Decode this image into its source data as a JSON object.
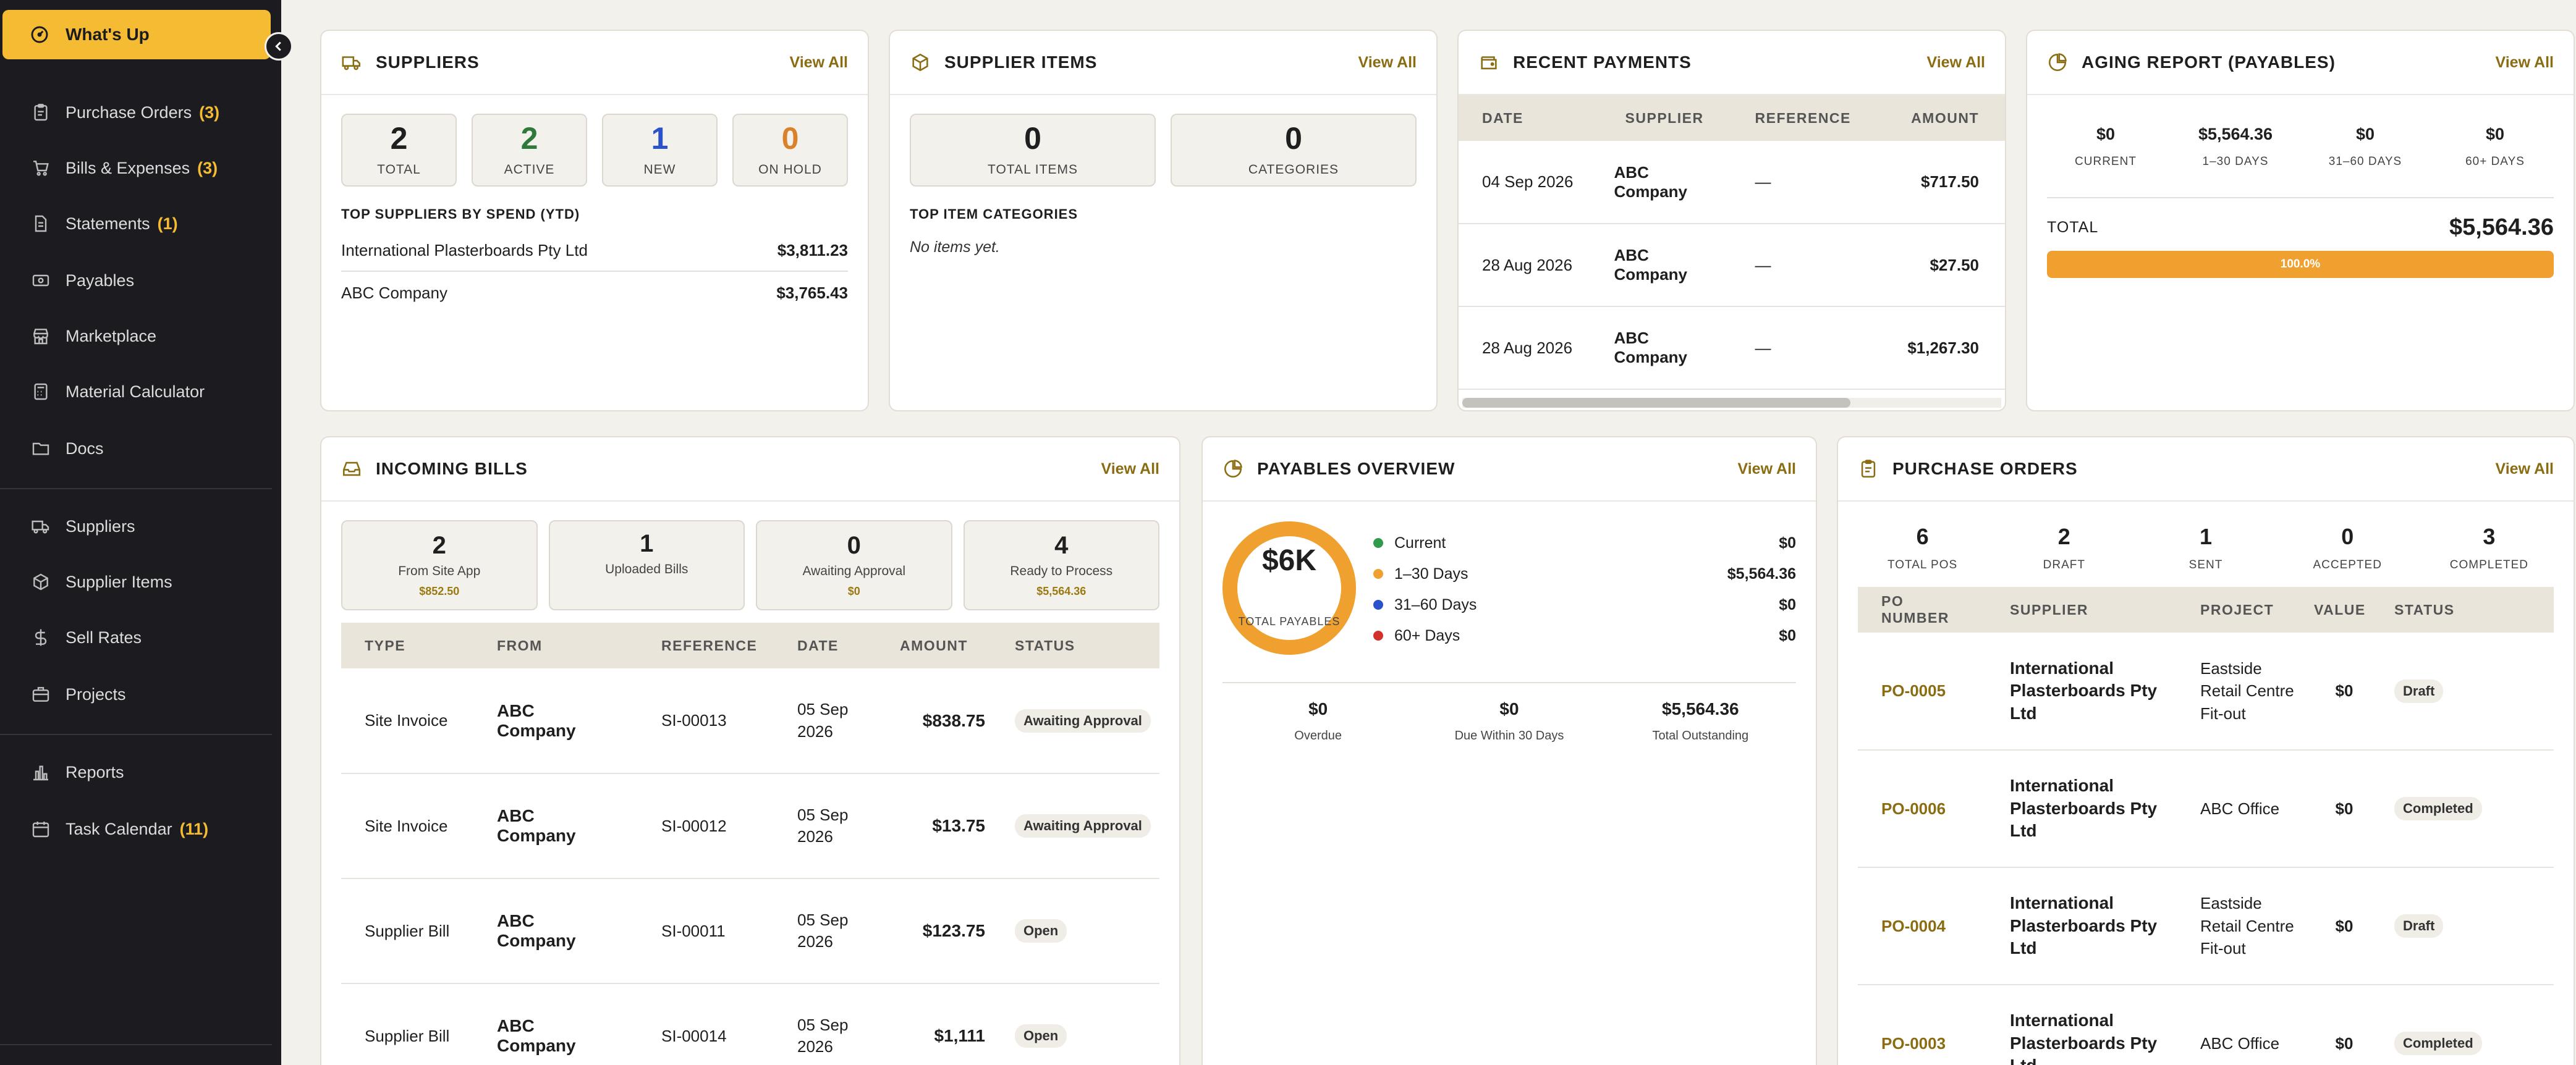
{
  "sidebar": {
    "active_label": "What's Up",
    "items": [
      {
        "label": "Purchase Orders",
        "count": "(3)",
        "icon": "clipboard-icon"
      },
      {
        "label": "Bills & Expenses",
        "count": "(3)",
        "icon": "cart-icon"
      },
      {
        "label": "Statements",
        "count": "(1)",
        "icon": "document-icon"
      },
      {
        "label": "Payables",
        "count": "",
        "icon": "money-icon"
      },
      {
        "label": "Marketplace",
        "count": "",
        "icon": "store-icon"
      },
      {
        "label": "Material Calculator",
        "count": "",
        "icon": "calculator-icon"
      },
      {
        "label": "Docs",
        "count": "",
        "icon": "folder-icon"
      },
      {
        "label": "Suppliers",
        "count": "",
        "icon": "truck-icon"
      },
      {
        "label": "Supplier Items",
        "count": "",
        "icon": "box-icon"
      },
      {
        "label": "Sell Rates",
        "count": "",
        "icon": "dollar-icon"
      },
      {
        "label": "Projects",
        "count": "",
        "icon": "briefcase-icon"
      },
      {
        "label": "Reports",
        "count": "",
        "icon": "bar-chart-icon"
      },
      {
        "label": "Task Calendar",
        "count": "(11)",
        "icon": "calendar-icon"
      }
    ]
  },
  "view_all": "View All",
  "suppliers": {
    "title": "SUPPLIERS",
    "stats": [
      {
        "value": "2",
        "label": "TOTAL",
        "color": "#1f1f1f"
      },
      {
        "value": "2",
        "label": "ACTIVE",
        "color": "#2f7a3a"
      },
      {
        "value": "1",
        "label": "NEW",
        "color": "#2a52c9"
      },
      {
        "value": "0",
        "label": "ON HOLD",
        "color": "#d9822b"
      }
    ],
    "top_heading": "TOP SUPPLIERS BY SPEND (YTD)",
    "top": [
      {
        "name": "International Plasterboards Pty Ltd",
        "amount": "$3,811.23"
      },
      {
        "name": "ABC Company",
        "amount": "$3,765.43"
      }
    ]
  },
  "supplier_items": {
    "title": "SUPPLIER ITEMS",
    "stats": [
      {
        "value": "0",
        "label": "TOTAL ITEMS"
      },
      {
        "value": "0",
        "label": "CATEGORIES"
      }
    ],
    "top_heading": "TOP ITEM CATEGORIES",
    "empty": "No items yet."
  },
  "recent_payments": {
    "title": "RECENT PAYMENTS",
    "columns": [
      "DATE",
      "SUPPLIER",
      "REFERENCE",
      "AMOUNT"
    ],
    "rows": [
      {
        "date": "04 Sep 2026",
        "supplier": "ABC Company",
        "reference": "—",
        "amount": "$717.50"
      },
      {
        "date": "28 Aug 2026",
        "supplier": "ABC Company",
        "reference": "—",
        "amount": "$27.50"
      },
      {
        "date": "28 Aug 2026",
        "supplier": "ABC Company",
        "reference": "—",
        "amount": "$1,267.30"
      }
    ]
  },
  "aging": {
    "title": "AGING REPORT (PAYABLES)",
    "buckets": [
      {
        "value": "$0",
        "label": "CURRENT"
      },
      {
        "value": "$5,564.36",
        "label": "1–30 DAYS"
      },
      {
        "value": "$0",
        "label": "31–60 DAYS"
      },
      {
        "value": "$0",
        "label": "60+ DAYS"
      }
    ],
    "total_label": "TOTAL",
    "total_value": "$5,564.36",
    "bar_label": "100.0%",
    "bar_fraction": 1.0,
    "bar_color": "#f0a02f"
  },
  "incoming_bills": {
    "title": "INCOMING BILLS",
    "stats": [
      {
        "value": "2",
        "label": "From Site App",
        "sub": "$852.50"
      },
      {
        "value": "1",
        "label": "Uploaded Bills",
        "sub": ""
      },
      {
        "value": "0",
        "label": "Awaiting Approval",
        "sub": "$0"
      },
      {
        "value": "4",
        "label": "Ready to Process",
        "sub": "$5,564.36"
      }
    ],
    "columns": [
      "TYPE",
      "FROM",
      "REFERENCE",
      "DATE",
      "AMOUNT",
      "STATUS"
    ],
    "rows": [
      {
        "type": "Site Invoice",
        "from": "ABC Company",
        "reference": "SI-00013",
        "date": "05 Sep 2026",
        "amount": "$838.75",
        "status": "Awaiting Approval"
      },
      {
        "type": "Site Invoice",
        "from": "ABC Company",
        "reference": "SI-00012",
        "date": "05 Sep 2026",
        "amount": "$13.75",
        "status": "Awaiting Approval"
      },
      {
        "type": "Supplier Bill",
        "from": "ABC Company",
        "reference": "SI-00011",
        "date": "05 Sep 2026",
        "amount": "$123.75",
        "status": "Open"
      },
      {
        "type": "Supplier Bill",
        "from": "ABC Company",
        "reference": "SI-00014",
        "date": "05 Sep 2026",
        "amount": "$1,111",
        "status": "Open"
      }
    ]
  },
  "payables_overview": {
    "title": "PAYABLES OVERVIEW",
    "donut_value": "$6K",
    "donut_label": "TOTAL PAYABLES",
    "donut_color": "#f0a02f",
    "legend": [
      {
        "label": "Current",
        "value": "$0",
        "color": "#2f9a4a"
      },
      {
        "label": "1–30 Days",
        "value": "$5,564.36",
        "color": "#f0a02f"
      },
      {
        "label": "31–60 Days",
        "value": "$0",
        "color": "#2a52c9"
      },
      {
        "label": "60+ Days",
        "value": "$0",
        "color": "#d3312b"
      }
    ],
    "summary": [
      {
        "value": "$0",
        "label": "Overdue"
      },
      {
        "value": "$0",
        "label": "Due Within 30 Days"
      },
      {
        "value": "$5,564.36",
        "label": "Total Outstanding"
      }
    ]
  },
  "purchase_orders": {
    "title": "PURCHASE ORDERS",
    "stats": [
      {
        "value": "6",
        "label": "TOTAL POS"
      },
      {
        "value": "2",
        "label": "DRAFT"
      },
      {
        "value": "1",
        "label": "SENT"
      },
      {
        "value": "0",
        "label": "ACCEPTED"
      },
      {
        "value": "3",
        "label": "COMPLETED"
      }
    ],
    "columns": [
      "PO NUMBER",
      "SUPPLIER",
      "PROJECT",
      "VALUE",
      "STATUS"
    ],
    "rows": [
      {
        "po": "PO-0005",
        "supplier": "International Plasterboards Pty Ltd",
        "project": "Eastside Retail Centre Fit-out",
        "value": "$0",
        "status": "Draft"
      },
      {
        "po": "PO-0006",
        "supplier": "International Plasterboards Pty Ltd",
        "project": "ABC Office",
        "value": "$0",
        "status": "Completed"
      },
      {
        "po": "PO-0004",
        "supplier": "International Plasterboards Pty Ltd",
        "project": "Eastside Retail Centre Fit-out",
        "value": "$0",
        "status": "Draft"
      },
      {
        "po": "PO-0003",
        "supplier": "International Plasterboards Pty Ltd",
        "project": "ABC Office",
        "value": "$0",
        "status": "Completed"
      }
    ]
  }
}
